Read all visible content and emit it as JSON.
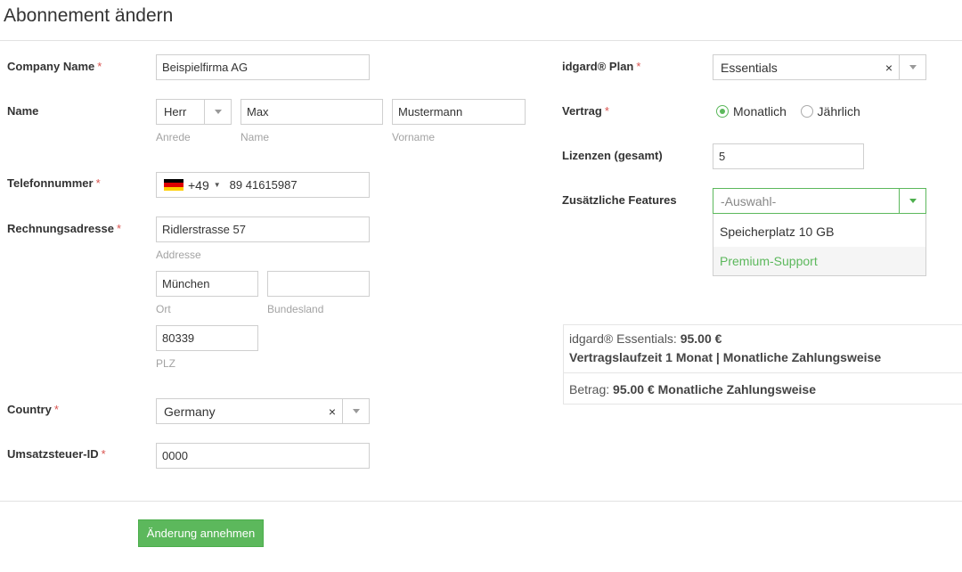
{
  "page": {
    "title": "Abonnement ändern"
  },
  "form": {
    "company": {
      "label": "Company Name",
      "required_mark": "*",
      "value": "Beispielfirma AG"
    },
    "name": {
      "label": "Name",
      "salutation": {
        "value": "Herr",
        "hint": "Anrede"
      },
      "first": {
        "value": "Max",
        "hint": "Name"
      },
      "last": {
        "value": "Mustermann",
        "hint": "Vorname"
      }
    },
    "phone": {
      "label": "Telefonnummer",
      "required_mark": "*",
      "dial_code": "+49",
      "value": "89 41615987",
      "flag": "de-flag-icon"
    },
    "address": {
      "label": "Rechnungsadresse",
      "required_mark": "*",
      "street": {
        "value": "Ridlerstrasse 57",
        "hint": "Addresse"
      },
      "city": {
        "value": "München",
        "hint": "Ort"
      },
      "state": {
        "value": "",
        "hint": "Bundesland"
      },
      "zip": {
        "value": "80339",
        "hint": "PLZ"
      }
    },
    "country": {
      "label": "Country",
      "required_mark": "*",
      "value": "Germany"
    },
    "vat": {
      "label": "Umsatzsteuer-ID",
      "required_mark": "*",
      "value": "0000"
    },
    "plan": {
      "label": "idgard® Plan",
      "required_mark": "*",
      "value": "Essentials"
    },
    "contract": {
      "label": "Vertrag",
      "required_mark": "*",
      "options": [
        {
          "label": "Monatlich",
          "checked": true
        },
        {
          "label": "Jährlich",
          "checked": false
        }
      ]
    },
    "licenses": {
      "label": "Lizenzen (gesamt)",
      "value": "5"
    },
    "features": {
      "label": "Zusätzliche Features",
      "placeholder": "-Auswahl-",
      "options": [
        {
          "label": "Speicherplatz 10 GB"
        },
        {
          "label": "Premium-Support"
        }
      ]
    }
  },
  "summary": {
    "line1_prefix": "idgard® Essentials: ",
    "line1_price": "95.00 €",
    "line2": "Vertragslaufzeit 1 Monat | Monatliche Zahlungsweise",
    "line3_prefix": "Betrag: ",
    "line3_value": "95.00 € Monatliche Zahlungsweise"
  },
  "actions": {
    "submit_label": "Änderung annehmen"
  },
  "colors": {
    "accent": "#5cb85c",
    "required": "#d9534f",
    "hint": "#a3a3a3"
  },
  "icons": {
    "clear": "×",
    "dropdown": "chevron-down-icon"
  }
}
